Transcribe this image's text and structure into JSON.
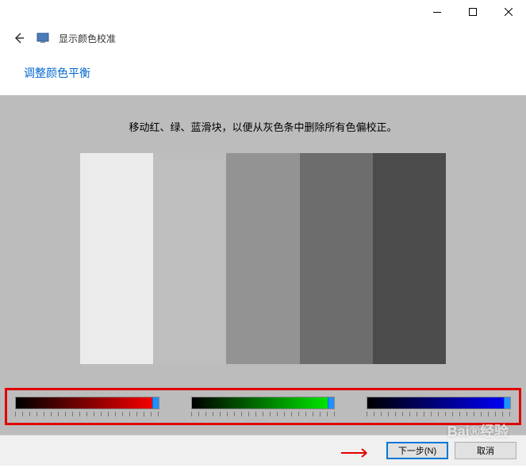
{
  "window": {
    "title": "显示颜色校准"
  },
  "header": {
    "section_title": "调整颜色平衡"
  },
  "content": {
    "instruction": "移动红、绿、蓝滑块，以便从灰色条中删除所有色偏校正。"
  },
  "sliders": {
    "red": {
      "value": 100
    },
    "green": {
      "value": 100
    },
    "blue": {
      "value": 100
    }
  },
  "footer": {
    "next_label": "下一步(N)",
    "cancel_label": "取消"
  },
  "watermark": {
    "text": "Bai®经验"
  }
}
